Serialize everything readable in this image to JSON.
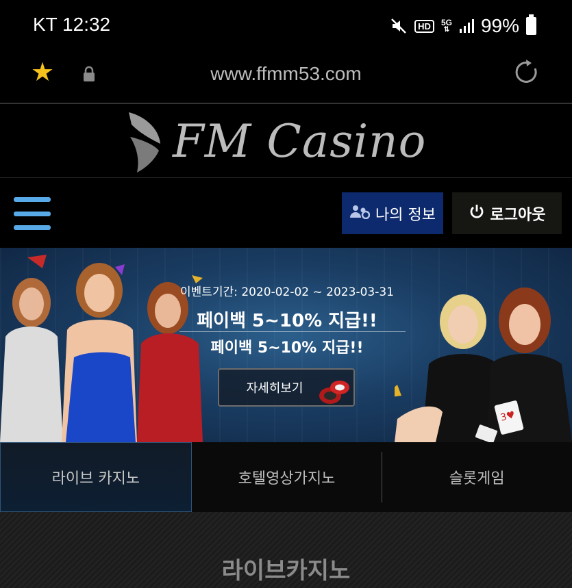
{
  "status_bar": {
    "carrier_time": "KT 12:32",
    "network": "5G",
    "hd": "HD",
    "battery": "99%"
  },
  "browser": {
    "url": "www.ffmm53.com"
  },
  "brand": {
    "logo_text": "FM Casino"
  },
  "nav": {
    "my_info_label": "나의 정보",
    "logout_label": "로그아웃"
  },
  "banner": {
    "event_period": "이벤트기간: 2020-02-02 ~ 2023-03-31",
    "headline": "페이백 5~10% 지급!!",
    "subheadline": "페이백 5~10% 지급!!",
    "detail_button": "자세히보기"
  },
  "tabs": [
    {
      "label": "라이브 카지노",
      "active": true
    },
    {
      "label": "호텔영상가지노",
      "active": false
    },
    {
      "label": "슬롯게임",
      "active": false
    }
  ],
  "section": {
    "title": "라이브카지노"
  },
  "colors": {
    "accent_blue": "#58a9e8",
    "info_button": "#0e2a6e",
    "star": "#f6c21b"
  }
}
